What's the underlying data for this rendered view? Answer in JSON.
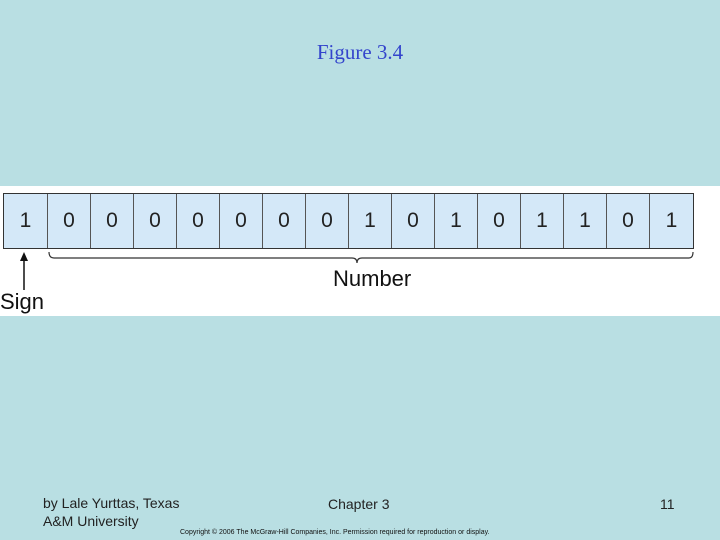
{
  "slide": {
    "title": "Figure 3.4",
    "figure": {
      "bits": [
        "1",
        "0",
        "0",
        "0",
        "0",
        "0",
        "0",
        "0",
        "1",
        "0",
        "1",
        "0",
        "1",
        "1",
        "0",
        "1"
      ],
      "number_label": "Number",
      "sign_label": "Sign"
    },
    "footer": {
      "author_line1": "by Lale Yurttas, Texas",
      "author_line2": "A&M University",
      "chapter": "Chapter 3",
      "page_number": "11",
      "copyright": "Copyright © 2006 The McGraw-Hill Companies, Inc. Permission required for reproduction or display."
    }
  }
}
